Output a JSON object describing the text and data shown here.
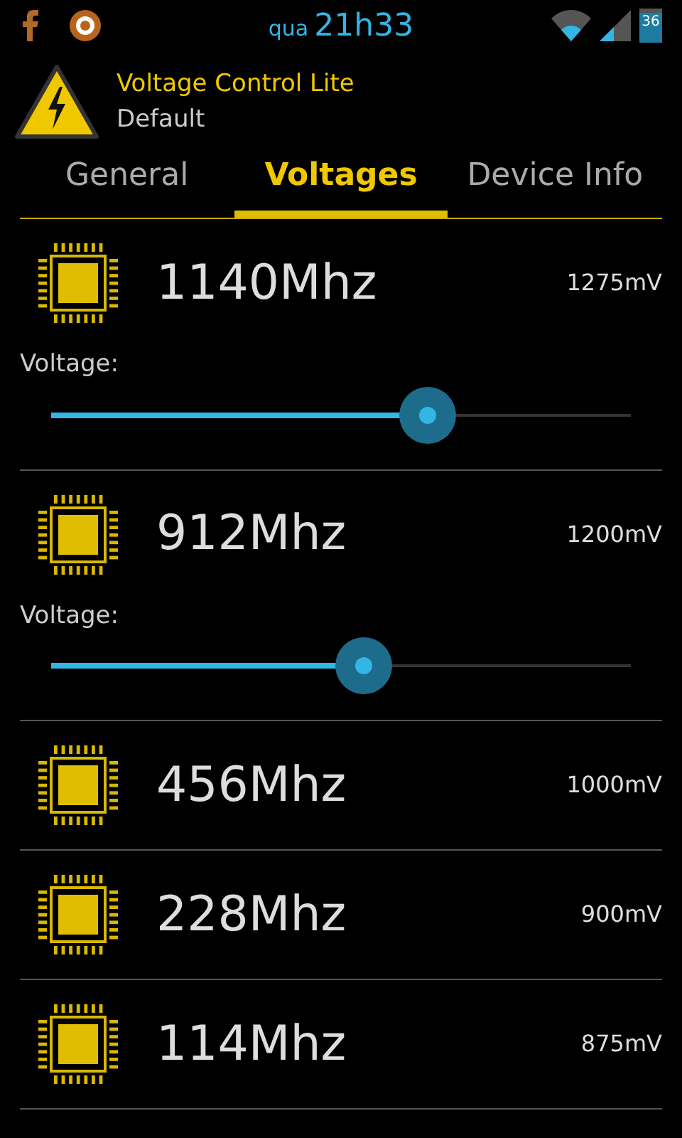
{
  "status_bar": {
    "day": "qua",
    "time": "21h33",
    "battery": "36"
  },
  "app": {
    "title": "Voltage Control Lite",
    "subtitle": "Default"
  },
  "tabs": [
    {
      "label": "General",
      "selected": false
    },
    {
      "label": "Voltages",
      "selected": true
    },
    {
      "label": "Device Info",
      "selected": false
    }
  ],
  "frequencies": [
    {
      "frequency": "1140Mhz",
      "voltage": "1275mV",
      "kind": "slider",
      "slider_label": "Voltage:",
      "level": 0.65
    },
    {
      "frequency": "912Mhz",
      "voltage": "1200mV",
      "kind": "slider",
      "slider_label": "Voltage:",
      "level": 0.54
    },
    {
      "frequency": "456Mhz",
      "voltage": "1000mV",
      "kind": "plain"
    },
    {
      "frequency": "228Mhz",
      "voltage": "900mV",
      "kind": "plain"
    },
    {
      "frequency": "114Mhz",
      "voltage": "875mV",
      "kind": "plain"
    }
  ]
}
